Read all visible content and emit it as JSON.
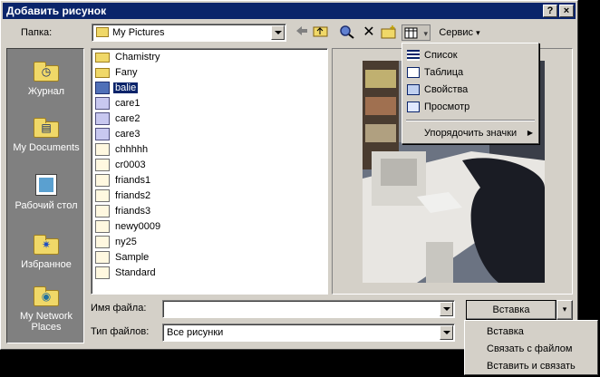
{
  "window": {
    "title": "Добавить рисунок",
    "help_label": "?",
    "close_label": "×"
  },
  "folder": {
    "label": "Папка:",
    "value": "My Pictures"
  },
  "toolbar": {
    "back_icon": "arrow-left-icon",
    "up_icon": "folder-up-icon",
    "search_icon": "search-web-icon",
    "delete_icon": "delete-x-icon",
    "new_folder_icon": "new-folder-icon",
    "views_icon": "views-icon",
    "tools_label": "Сервис"
  },
  "places": [
    {
      "label": "Журнал",
      "icon": "history-icon",
      "glyph": "◷"
    },
    {
      "label": "My Documents",
      "icon": "my-documents-icon",
      "glyph": "▤"
    },
    {
      "label": "Рабочий стол",
      "icon": "desktop-icon",
      "glyph": "▣"
    },
    {
      "label": "Избранное",
      "icon": "favorites-icon",
      "glyph": "✷"
    },
    {
      "label": "My Network Places",
      "icon": "network-places-icon",
      "glyph": "◉"
    }
  ],
  "files": [
    {
      "name": "Chamistry",
      "type": "folder"
    },
    {
      "name": "Fany",
      "type": "folder"
    },
    {
      "name": "balie",
      "type": "blue",
      "selected": true
    },
    {
      "name": "care1",
      "type": "pen"
    },
    {
      "name": "care2",
      "type": "pen"
    },
    {
      "name": "care3",
      "type": "pen"
    },
    {
      "name": "chhhhh",
      "type": "img"
    },
    {
      "name": "cr0003",
      "type": "img"
    },
    {
      "name": "friands1",
      "type": "img"
    },
    {
      "name": "friands2",
      "type": "img"
    },
    {
      "name": "friands3",
      "type": "img"
    },
    {
      "name": "newy0009",
      "type": "gif"
    },
    {
      "name": "ny25",
      "type": "img"
    },
    {
      "name": "Sample",
      "type": "img"
    },
    {
      "name": "Standard",
      "type": "gif"
    }
  ],
  "views_menu": {
    "items": [
      "Список",
      "Таблица",
      "Свойства",
      "Просмотр"
    ],
    "arrange": "Упорядочить значки"
  },
  "filename": {
    "label": "Имя файла:",
    "value": ""
  },
  "filetype": {
    "label": "Тип файлов:",
    "value": "Все рисунки"
  },
  "insert": {
    "button_label": "Вставка",
    "menu": [
      "Вставка",
      "Связать с файлом",
      "Вставить и связать"
    ]
  },
  "colors": {
    "titlebar": "#0a246a",
    "face": "#d4d0c8",
    "selection": "#0a246a"
  }
}
